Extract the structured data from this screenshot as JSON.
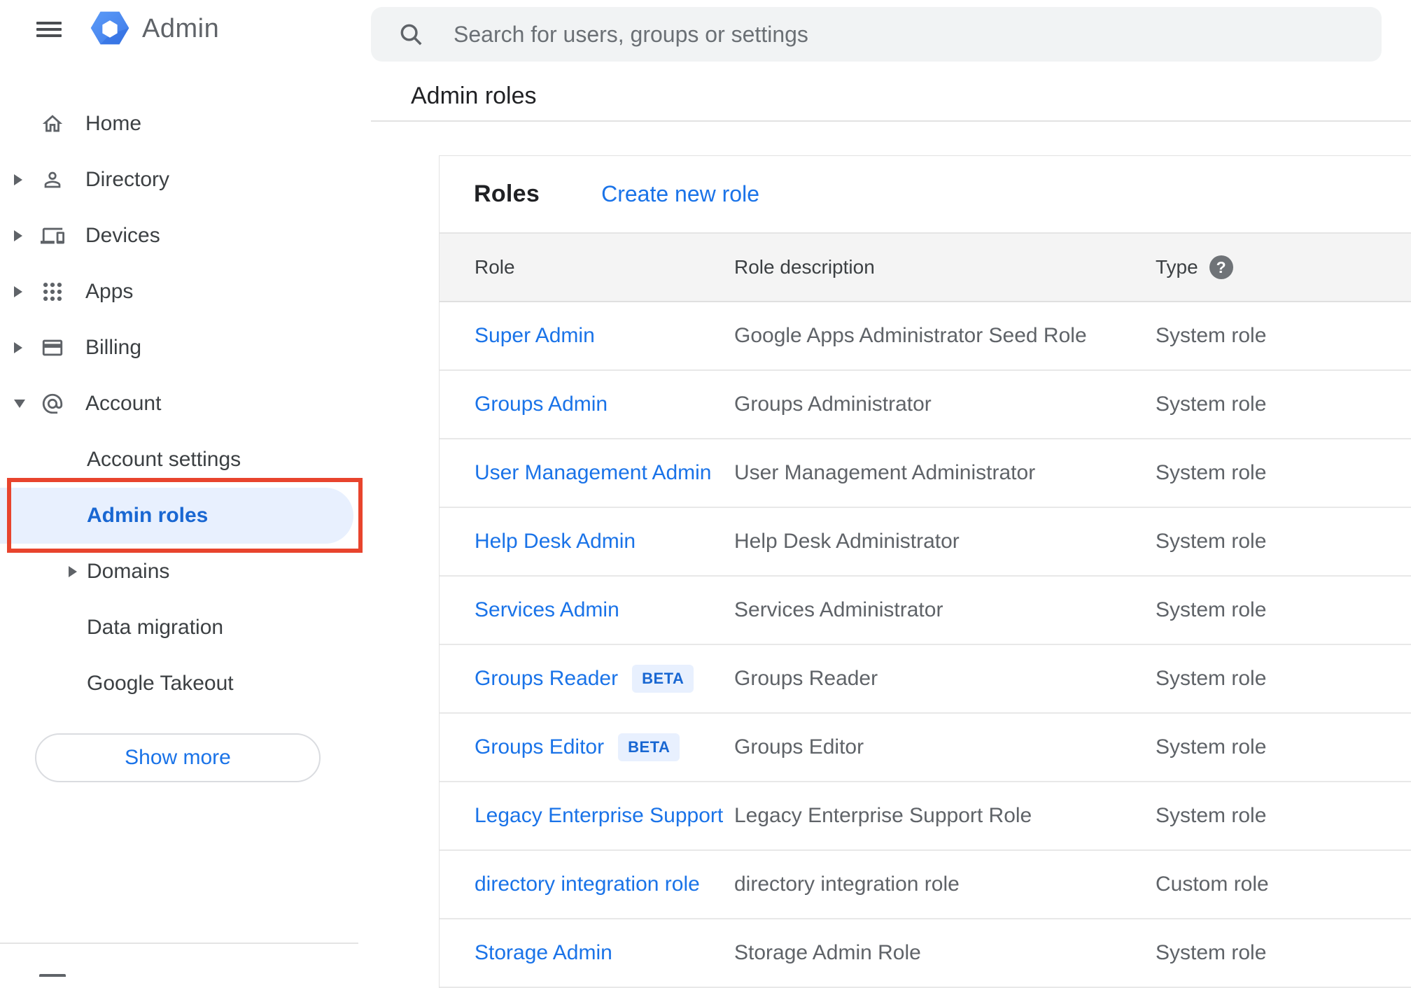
{
  "app": {
    "name": "Admin"
  },
  "search": {
    "placeholder": "Search for users, groups or settings"
  },
  "page": {
    "title": "Admin roles"
  },
  "sidebar": {
    "items": [
      {
        "label": "Home",
        "icon": "home-icon",
        "expandable": false
      },
      {
        "label": "Directory",
        "icon": "person-icon",
        "expandable": true
      },
      {
        "label": "Devices",
        "icon": "devices-icon",
        "expandable": true
      },
      {
        "label": "Apps",
        "icon": "apps-grid-icon",
        "expandable": true
      },
      {
        "label": "Billing",
        "icon": "credit-card-icon",
        "expandable": true
      },
      {
        "label": "Account",
        "icon": "at-sign-icon",
        "expandable": true,
        "expanded": true
      }
    ],
    "account_children": [
      {
        "label": "Account settings",
        "selected": false,
        "expandable": false
      },
      {
        "label": "Admin roles",
        "selected": true,
        "expandable": false
      },
      {
        "label": "Domains",
        "selected": false,
        "expandable": true
      },
      {
        "label": "Data migration",
        "selected": false,
        "expandable": false
      },
      {
        "label": "Google Takeout",
        "selected": false,
        "expandable": false
      }
    ],
    "show_more_label": "Show more"
  },
  "roles_card": {
    "heading": "Roles",
    "create_link": "Create new role",
    "columns": [
      "Role",
      "Role description",
      "Type"
    ],
    "beta_badge_label": "BETA",
    "rows": [
      {
        "role": "Super Admin",
        "beta": false,
        "description": "Google Apps Administrator Seed Role",
        "type": "System role"
      },
      {
        "role": "Groups Admin",
        "beta": false,
        "description": "Groups Administrator",
        "type": "System role"
      },
      {
        "role": "User Management Admin",
        "beta": false,
        "description": "User Management Administrator",
        "type": "System role"
      },
      {
        "role": "Help Desk Admin",
        "beta": false,
        "description": "Help Desk Administrator",
        "type": "System role"
      },
      {
        "role": "Services Admin",
        "beta": false,
        "description": "Services Administrator",
        "type": "System role"
      },
      {
        "role": "Groups Reader",
        "beta": true,
        "description": "Groups Reader",
        "type": "System role"
      },
      {
        "role": "Groups Editor",
        "beta": true,
        "description": "Groups Editor",
        "type": "System role"
      },
      {
        "role": "Legacy Enterprise Support",
        "beta": false,
        "description": "Legacy Enterprise Support Role",
        "type": "System role"
      },
      {
        "role": "directory integration role",
        "beta": false,
        "description": "directory integration role",
        "type": "Custom role"
      },
      {
        "role": "Storage Admin",
        "beta": false,
        "description": "Storage Admin Role",
        "type": "System role"
      }
    ]
  },
  "colors": {
    "link_blue": "#1a73e8",
    "selected_blue": "#1967d2",
    "selected_bg": "#e8f0fe",
    "badge_bg": "#e8f0fe",
    "badge_text": "#1967d2",
    "annotation_red": "#e8442d",
    "table_header_bg": "#f4f4f4",
    "text_dark": "#202124",
    "text_gray": "#5f6368"
  }
}
